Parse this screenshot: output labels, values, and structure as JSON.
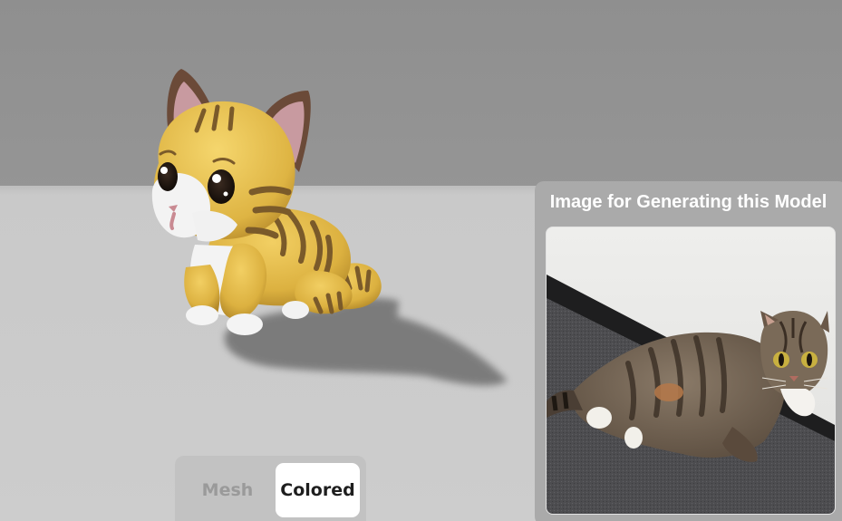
{
  "reference_panel": {
    "title": "Image for Generating this Model"
  },
  "view_toggle": {
    "mesh_label": "Mesh",
    "colored_label": "Colored",
    "selected": "Colored"
  },
  "colors": {
    "wall": "#8f8f8f",
    "floor": "#cdcdcd",
    "toggle_bg": "#c2c2c2",
    "toggle_active_bg": "#ffffff",
    "panel_bg": "#aaaaaa",
    "model_fur": "#e2b945",
    "model_stripes": "#7a5a2a",
    "model_ear_inner": "#c89aa0"
  }
}
